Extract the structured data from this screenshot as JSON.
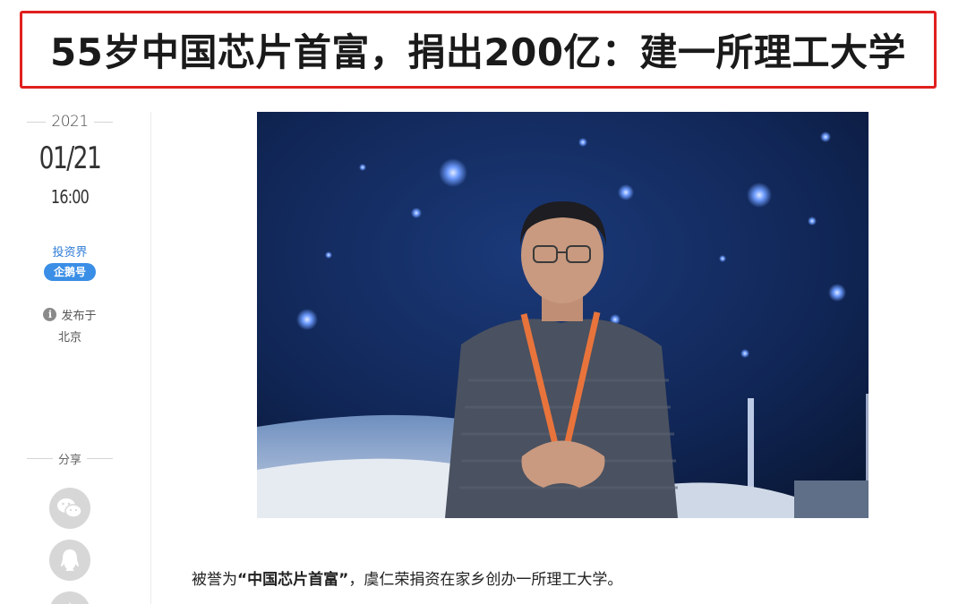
{
  "headline": "55岁中国芯片首富，捐出200亿：建一所理工大学",
  "meta": {
    "year": "2021",
    "date": "01/21",
    "time": "16:00",
    "author": "投资界",
    "badge": "企鹅号",
    "published_label": "发布于",
    "location": "北京"
  },
  "share": {
    "label": "分享",
    "buttons": [
      "wechat-icon",
      "qq-icon",
      "qzone-icon"
    ]
  },
  "body": {
    "prefix": "被誉为",
    "highlight": "“中国芯片首富”",
    "suffix": "，虞仁荣捐资在家乡创办一所理工大学。"
  },
  "colors": {
    "title_border": "#e0201e",
    "link": "#2e7bd6",
    "badge": "#3a8ee6"
  }
}
